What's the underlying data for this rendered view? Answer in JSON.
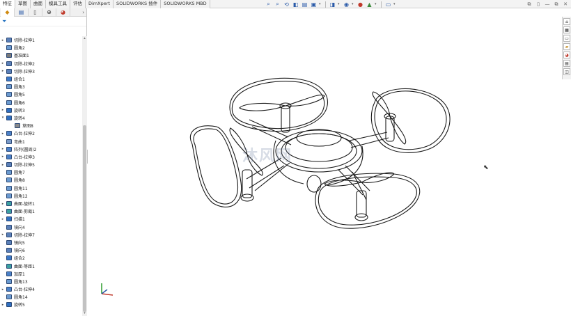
{
  "command_tabs": [
    "特征",
    "草图",
    "曲面",
    "模具工具",
    "评估",
    "DimXpert",
    "SOLIDWORKS 插件",
    "SOLIDWORKS MBD"
  ],
  "active_tab_index": 0,
  "hud_icons": [
    "zoom-fit-icon",
    "zoom-area-icon",
    "previous-view-icon",
    "section-view-icon",
    "dynamic-annotation-icon",
    "view-orientation-icon",
    "display-style-icon",
    "hide-show-icon",
    "edit-appearance-icon",
    "apply-scene-icon",
    "view-settings-icon"
  ],
  "window_controls": [
    "restore-icon",
    "tile-icon",
    "minimize-icon",
    "maximize-icon",
    "close-icon"
  ],
  "window_control_glyphs": [
    "⧉",
    "▯",
    "—",
    "⧉",
    "✕"
  ],
  "fm_tab_icons": [
    "feature-manager-icon",
    "property-manager-icon",
    "configuration-manager-icon",
    "dimxpert-icon",
    "display-manager-icon"
  ],
  "fm_more_glyph": "›",
  "tree_items": [
    {
      "label": "切除-拉伸1",
      "expand": true,
      "icon": "cut-extrude-icon",
      "color": "#5a7fb8"
    },
    {
      "label": "圆角2",
      "expand": false,
      "icon": "fillet-icon",
      "color": "#6a9ad0"
    },
    {
      "label": "基准面1",
      "expand": false,
      "icon": "plane-icon",
      "color": "#7a7a7a"
    },
    {
      "label": "切除-拉伸2",
      "expand": true,
      "icon": "cut-extrude-icon",
      "color": "#5a7fb8"
    },
    {
      "label": "切除-拉伸3",
      "expand": true,
      "icon": "cut-extrude-icon",
      "color": "#5a7fb8"
    },
    {
      "label": "组合1",
      "expand": false,
      "icon": "combine-icon",
      "color": "#3a78c8"
    },
    {
      "label": "圆角3",
      "expand": false,
      "icon": "fillet-icon",
      "color": "#6a9ad0"
    },
    {
      "label": "圆角5",
      "expand": false,
      "icon": "fillet-icon",
      "color": "#6a9ad0"
    },
    {
      "label": "圆角6",
      "expand": false,
      "icon": "fillet-icon",
      "color": "#6a9ad0"
    },
    {
      "label": "旋转3",
      "expand": true,
      "icon": "revolve-icon",
      "color": "#2f6fc0"
    },
    {
      "label": "旋转4",
      "expand": true,
      "icon": "revolve-icon",
      "color": "#2f6fc0",
      "open": true
    },
    {
      "label": "草图8",
      "expand": false,
      "icon": "sketch-icon",
      "color": "#8a8a8a",
      "indent": 1
    },
    {
      "label": "凸台-拉伸2",
      "expand": true,
      "icon": "boss-extrude-icon",
      "color": "#4a80c8"
    },
    {
      "label": "弯曲1",
      "expand": false,
      "icon": "flex-icon",
      "color": "#7a9ac8"
    },
    {
      "label": "阵列(圆周)2",
      "expand": true,
      "icon": "circular-pattern-icon",
      "color": "#4a80c8"
    },
    {
      "label": "凸台-拉伸3",
      "expand": true,
      "icon": "boss-extrude-icon",
      "color": "#4a80c8"
    },
    {
      "label": "切除-拉伸5",
      "expand": true,
      "icon": "cut-extrude-icon",
      "color": "#5a7fb8"
    },
    {
      "label": "圆角7",
      "expand": false,
      "icon": "fillet-icon",
      "color": "#6a9ad0"
    },
    {
      "label": "圆角8",
      "expand": false,
      "icon": "fillet-icon",
      "color": "#6a9ad0"
    },
    {
      "label": "圆角11",
      "expand": false,
      "icon": "fillet-icon",
      "color": "#6a9ad0"
    },
    {
      "label": "圆角12",
      "expand": false,
      "icon": "fillet-icon",
      "color": "#6a9ad0"
    },
    {
      "label": "曲面-旋转1",
      "expand": true,
      "icon": "surface-revolve-icon",
      "color": "#3aa0a0"
    },
    {
      "label": "曲面-剪裁1",
      "expand": true,
      "icon": "surface-trim-icon",
      "color": "#3aa0a0"
    },
    {
      "label": "扫描1",
      "expand": true,
      "icon": "sweep-icon",
      "color": "#2f6fc0"
    },
    {
      "label": "镜向4",
      "expand": false,
      "icon": "mirror-icon",
      "color": "#5a7fb8"
    },
    {
      "label": "切除-拉伸7",
      "expand": true,
      "icon": "cut-extrude-icon",
      "color": "#5a7fb8"
    },
    {
      "label": "镜向5",
      "expand": false,
      "icon": "mirror-icon",
      "color": "#5a7fb8"
    },
    {
      "label": "镜向6",
      "expand": false,
      "icon": "mirror-icon",
      "color": "#5a7fb8"
    },
    {
      "label": "组合2",
      "expand": false,
      "icon": "combine-icon",
      "color": "#3a78c8"
    },
    {
      "label": "曲面-等距1",
      "expand": false,
      "icon": "surface-offset-icon",
      "color": "#3aa0a0"
    },
    {
      "label": "加厚1",
      "expand": false,
      "icon": "thicken-icon",
      "color": "#4a80c8"
    },
    {
      "label": "圆角13",
      "expand": false,
      "icon": "fillet-icon",
      "color": "#6a9ad0"
    },
    {
      "label": "凸台-拉伸4",
      "expand": true,
      "icon": "boss-extrude-icon",
      "color": "#4a80c8"
    },
    {
      "label": "圆角14",
      "expand": false,
      "icon": "fillet-icon",
      "color": "#6a9ad0"
    },
    {
      "label": "旋转5",
      "expand": true,
      "icon": "revolve-icon",
      "color": "#2f6fc0"
    }
  ],
  "taskpane_icons": [
    "home-icon",
    "resources-icon",
    "design-library-icon",
    "file-explorer-icon",
    "appearances-icon",
    "custom-properties-icon",
    "forum-icon"
  ],
  "watermark": "沐风网",
  "colors": {
    "accent": "#2a5aa8",
    "model_line": "#1a1a1a"
  }
}
